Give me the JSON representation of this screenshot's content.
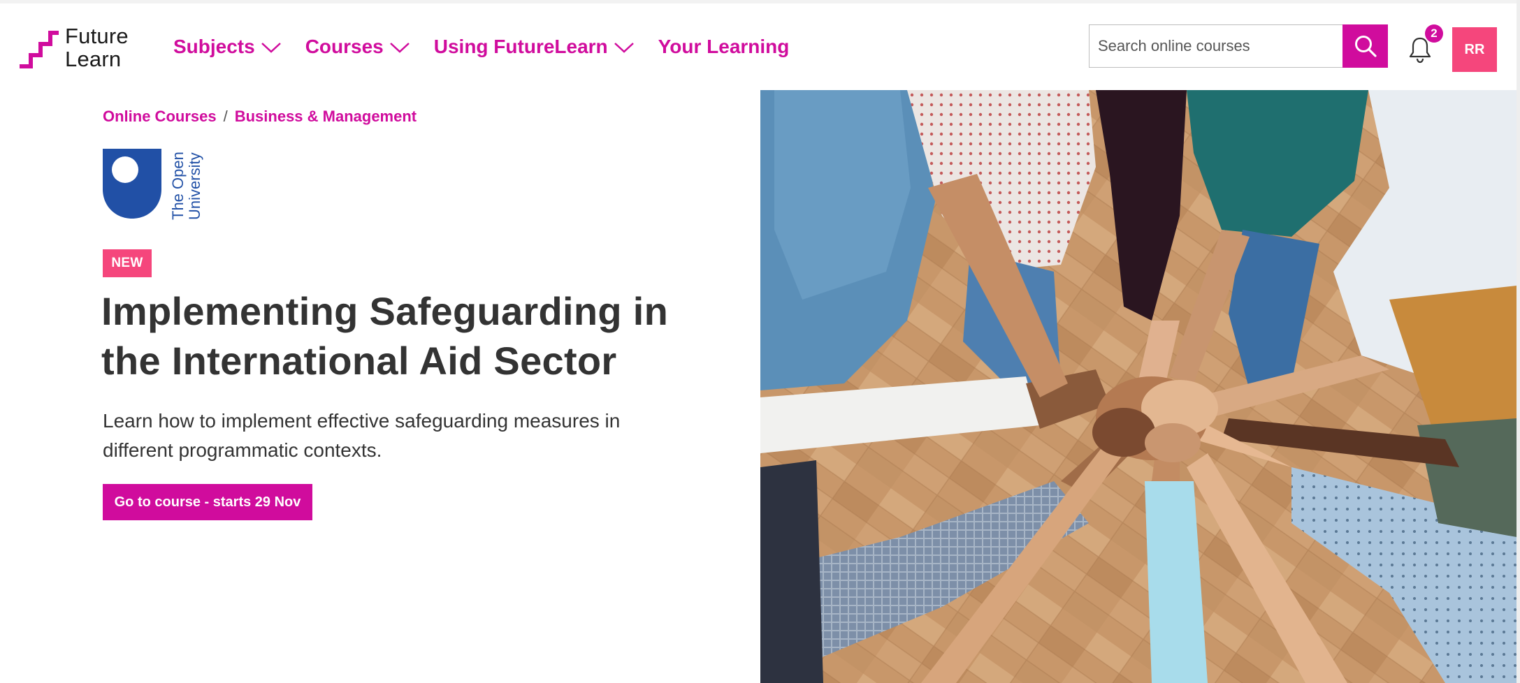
{
  "brand": {
    "logo_text_line1": "Future",
    "logo_text_line2": "Learn",
    "accent_color": "#d00c9d",
    "badge_color": "#f5467c"
  },
  "nav": {
    "items": [
      {
        "label": "Subjects",
        "has_dropdown": true
      },
      {
        "label": "Courses",
        "has_dropdown": true
      },
      {
        "label": "Using FutureLearn",
        "has_dropdown": true
      },
      {
        "label": "Your Learning",
        "has_dropdown": false
      }
    ]
  },
  "search": {
    "placeholder": "Search online courses",
    "icon": "search-icon"
  },
  "notifications": {
    "icon": "bell-icon",
    "count": "2"
  },
  "user": {
    "initials": "RR"
  },
  "breadcrumb": {
    "items": [
      "Online Courses",
      "Business & Management"
    ],
    "separator": "/"
  },
  "partner": {
    "name_line1": "The Open",
    "name_line2": "University"
  },
  "course": {
    "badge": "NEW",
    "title_line1": "Implementing Safeguarding in",
    "title_line2": "the International Aid Sector",
    "description_line1": "Learn how to implement effective safeguarding measures in",
    "description_line2": "different programmatic contexts.",
    "cta_label": "Go to course - starts 29 Nov"
  }
}
